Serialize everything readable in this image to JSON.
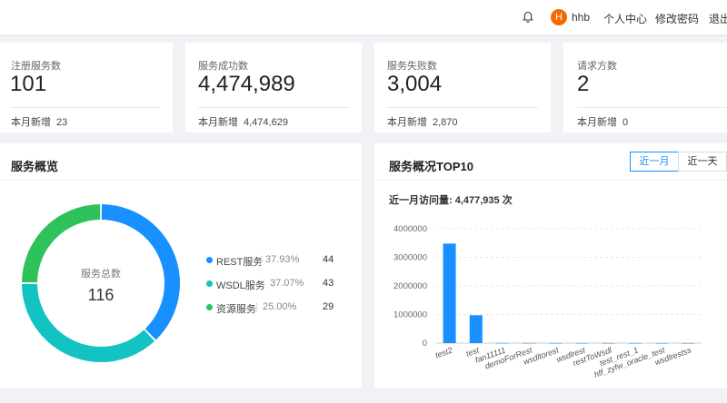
{
  "header": {
    "avatar_letter": "H",
    "username": "hhb",
    "nav": [
      "个人中心",
      "修改密码",
      "退出系统"
    ]
  },
  "stats": [
    {
      "label": "注册服务数",
      "value": "101",
      "foot_label": "本月新增",
      "foot_value": "23"
    },
    {
      "label": "服务成功数",
      "value": "4,474,989",
      "foot_label": "本月新增",
      "foot_value": "4,474,629"
    },
    {
      "label": "服务失败数",
      "value": "3,004",
      "foot_label": "本月新增",
      "foot_value": "2,870"
    },
    {
      "label": "请求方数",
      "value": "2",
      "foot_label": "本月新增",
      "foot_value": "0"
    }
  ],
  "overview": {
    "title": "服务概览",
    "center_label": "服务总数",
    "center_value": "116",
    "legend": [
      {
        "name": "REST服务",
        "pct": "37.93%",
        "count": "44",
        "color": "#1890ff"
      },
      {
        "name": "WSDL服务",
        "pct": "37.07%",
        "count": "43",
        "color": "#13c2c2"
      },
      {
        "name": "资源服务",
        "pct": "25.00%",
        "count": "29",
        "color": "#2fc25b"
      }
    ]
  },
  "top10": {
    "title": "服务概况TOP10",
    "tabs": [
      "近一月",
      "近一天"
    ],
    "active_tab": 0,
    "visits_text": "近一月访问量: 4,477,935 次"
  },
  "chart_data": [
    {
      "type": "pie",
      "title": "",
      "categories": [
        "REST服务",
        "WSDL服务",
        "资源服务"
      ],
      "values": [
        44,
        43,
        29
      ],
      "colors": [
        "#1890ff",
        "#13c2c2",
        "#2fc25b"
      ]
    },
    {
      "type": "bar",
      "title": "",
      "categories": [
        "test2",
        "test",
        "fan11111",
        "demoForRest",
        "wsdltorest",
        "wsdlrest",
        "restToWsdl",
        "test_rest_1",
        "hff_zyfw_oracle_test",
        "wsdlrestss"
      ],
      "values": [
        3480000,
        975000,
        6000,
        4000,
        3000,
        2500,
        2000,
        1500,
        1000,
        800
      ],
      "ylim": [
        0,
        4000000
      ],
      "yticks": [
        "0",
        "1000000",
        "2000000",
        "3000000",
        "4000000"
      ],
      "color": "#1890ff",
      "grid": true
    }
  ]
}
